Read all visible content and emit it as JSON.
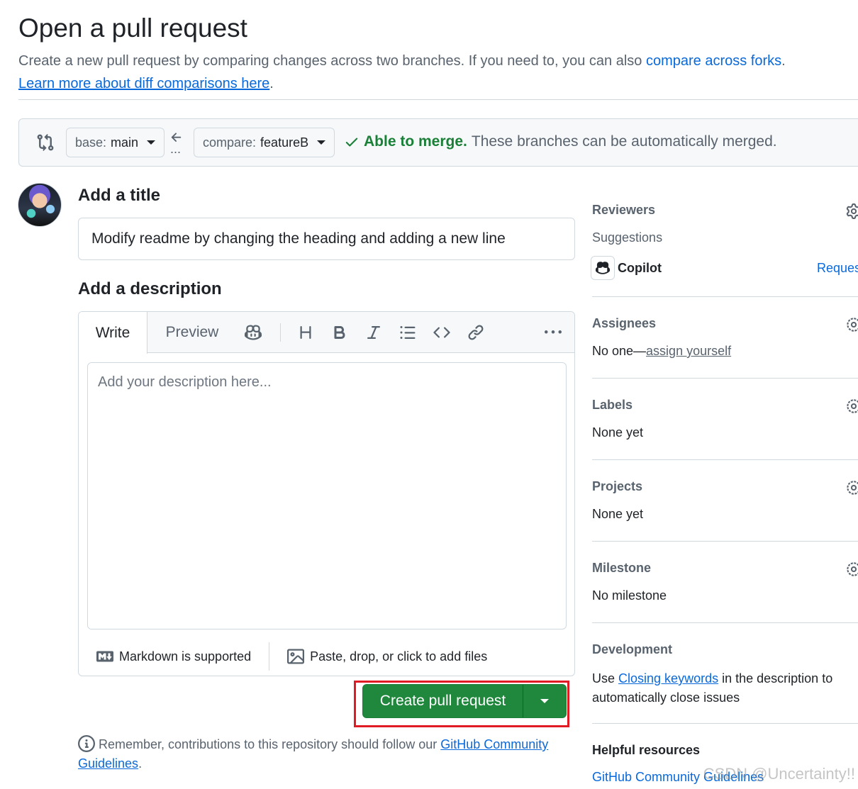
{
  "header": {
    "title": "Open a pull request",
    "subtitle": "Create a new pull request by comparing changes across two branches. If you need to, you can also",
    "forks_link": "compare across forks",
    "subtitle_end": ".",
    "learn_link": "Learn more about diff comparisons here",
    "learn_end": "."
  },
  "compare": {
    "base_prefix": "base:",
    "base_branch": "main",
    "compare_prefix": "compare:",
    "compare_branch": "featureB",
    "dots": "...",
    "merge_ok": "Able to merge.",
    "merge_text": "These branches can be automatically merged."
  },
  "form": {
    "title_heading": "Add a title",
    "title_value": "Modify readme by changing the heading and adding a new line",
    "desc_heading": "Add a description",
    "tab_write": "Write",
    "tab_preview": "Preview",
    "desc_placeholder": "Add your description here...",
    "markdown_note": "Markdown is supported",
    "attach_note": "Paste, drop, or click to add files",
    "create_button": "Create pull request",
    "reminder": "Remember, contributions to this repository should follow our",
    "guidelines_link_1": "GitHub Community",
    "guidelines_link_2": "Guidelines",
    "reminder_end": "."
  },
  "sidebar": {
    "reviewers": {
      "heading": "Reviewers",
      "suggestions": "Suggestions",
      "copilot": "Copilot",
      "request": "Request"
    },
    "assignees": {
      "heading": "Assignees",
      "text": "No one—",
      "link": "assign yourself"
    },
    "labels": {
      "heading": "Labels",
      "text": "None yet"
    },
    "projects": {
      "heading": "Projects",
      "text": "None yet"
    },
    "milestone": {
      "heading": "Milestone",
      "text": "No milestone"
    },
    "development": {
      "heading": "Development",
      "pre": "Use",
      "link": "Closing keywords",
      "post": "in the description to",
      "post2": "automatically close issues"
    },
    "helpful": {
      "heading": "Helpful resources",
      "link": "GitHub Community Guidelines"
    }
  },
  "watermark": "CSDN @Uncertainty!!",
  "colors": {
    "green": "#1f883d",
    "link": "#0969da",
    "highlight": "#e01b24",
    "success": "#1a7f37"
  }
}
